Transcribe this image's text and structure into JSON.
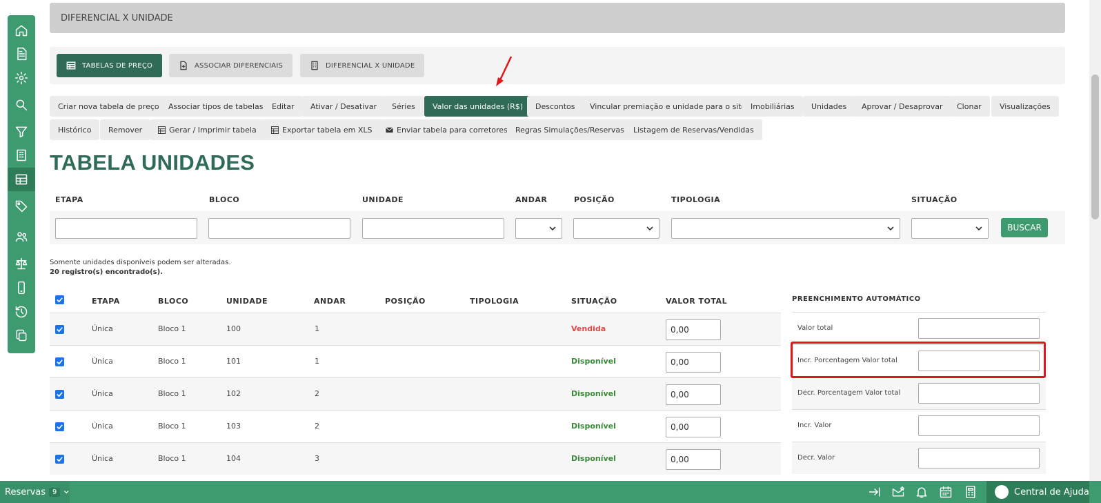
{
  "header": {
    "title": "DIFERENCIAL X UNIDADE"
  },
  "top_tabs": [
    {
      "label": "TABELAS DE PREÇO",
      "icon": "table-icon",
      "active": true
    },
    {
      "label": "ASSOCIAR DIFERENCIAIS",
      "icon": "document-plus-icon",
      "active": false
    },
    {
      "label": "DIFERENCIAL X UNIDADE",
      "icon": "building-icon",
      "active": false
    }
  ],
  "actions_row1": [
    "Criar nova tabela de preço",
    "Associar tipos de tabelas",
    "Editar",
    "Ativar / Desativar",
    "Séries",
    "Valor das unidades (R$)",
    "Descontos",
    "Vincular premiação e unidade para o site",
    "Imobiliárias",
    "Unidades",
    "Aprovar / Desaprovar",
    "Clonar",
    "Visualizações"
  ],
  "actions_row2": [
    "Histórico",
    "Remover",
    "Gerar / Imprimir tabela",
    "Exportar tabela em XLS",
    "Enviar tabela para corretores",
    "Regras Simulações/Reservas",
    "Listagem de Reservas/Vendidas"
  ],
  "page_title": "TABELA UNIDADES",
  "filters": {
    "labels": [
      "ETAPA",
      "BLOCO",
      "UNIDADE",
      "ANDAR",
      "POSIÇÃO",
      "TIPOLOGIA",
      "SITUAÇÃO"
    ],
    "search_button": "BUSCAR"
  },
  "notes": {
    "availability": "Somente unidades disponíveis podem ser alteradas.",
    "records": "20 registro(s) encontrado(s)."
  },
  "table": {
    "headers": [
      "ETAPA",
      "BLOCO",
      "UNIDADE",
      "ANDAR",
      "POSIÇÃO",
      "TIPOLOGIA",
      "SITUAÇÃO",
      "VALOR TOTAL"
    ],
    "rows": [
      {
        "etapa": "Única",
        "bloco": "Bloco 1",
        "unidade": "100",
        "andar": "1",
        "situacao": "Vendida",
        "valor": "0,00"
      },
      {
        "etapa": "Única",
        "bloco": "Bloco 1",
        "unidade": "101",
        "andar": "1",
        "situacao": "Disponível",
        "valor": "0,00"
      },
      {
        "etapa": "Única",
        "bloco": "Bloco 1",
        "unidade": "102",
        "andar": "2",
        "situacao": "Disponível",
        "valor": "0,00"
      },
      {
        "etapa": "Única",
        "bloco": "Bloco 1",
        "unidade": "103",
        "andar": "2",
        "situacao": "Disponível",
        "valor": "0,00"
      },
      {
        "etapa": "Única",
        "bloco": "Bloco 1",
        "unidade": "104",
        "andar": "3",
        "situacao": "Disponível",
        "valor": "0,00"
      }
    ]
  },
  "auto_fill": {
    "title": "PREENCHIMENTO AUTOMÁTICO",
    "fields": [
      "Valor total",
      "Incr. Porcentagem Valor total",
      "Decr. Porcentagem Valor total",
      "Incr. Valor",
      "Decr. Valor"
    ]
  },
  "bottom_bar": {
    "reservas_label": "Reservas",
    "reservas_count": "9",
    "help_label": "Central de Ajuda"
  },
  "colors": {
    "brand": "#3e9a6f",
    "dark_green": "#2f6b56",
    "sold": "#e04747",
    "available": "#3a8a3a",
    "highlight": "#e0161b"
  }
}
